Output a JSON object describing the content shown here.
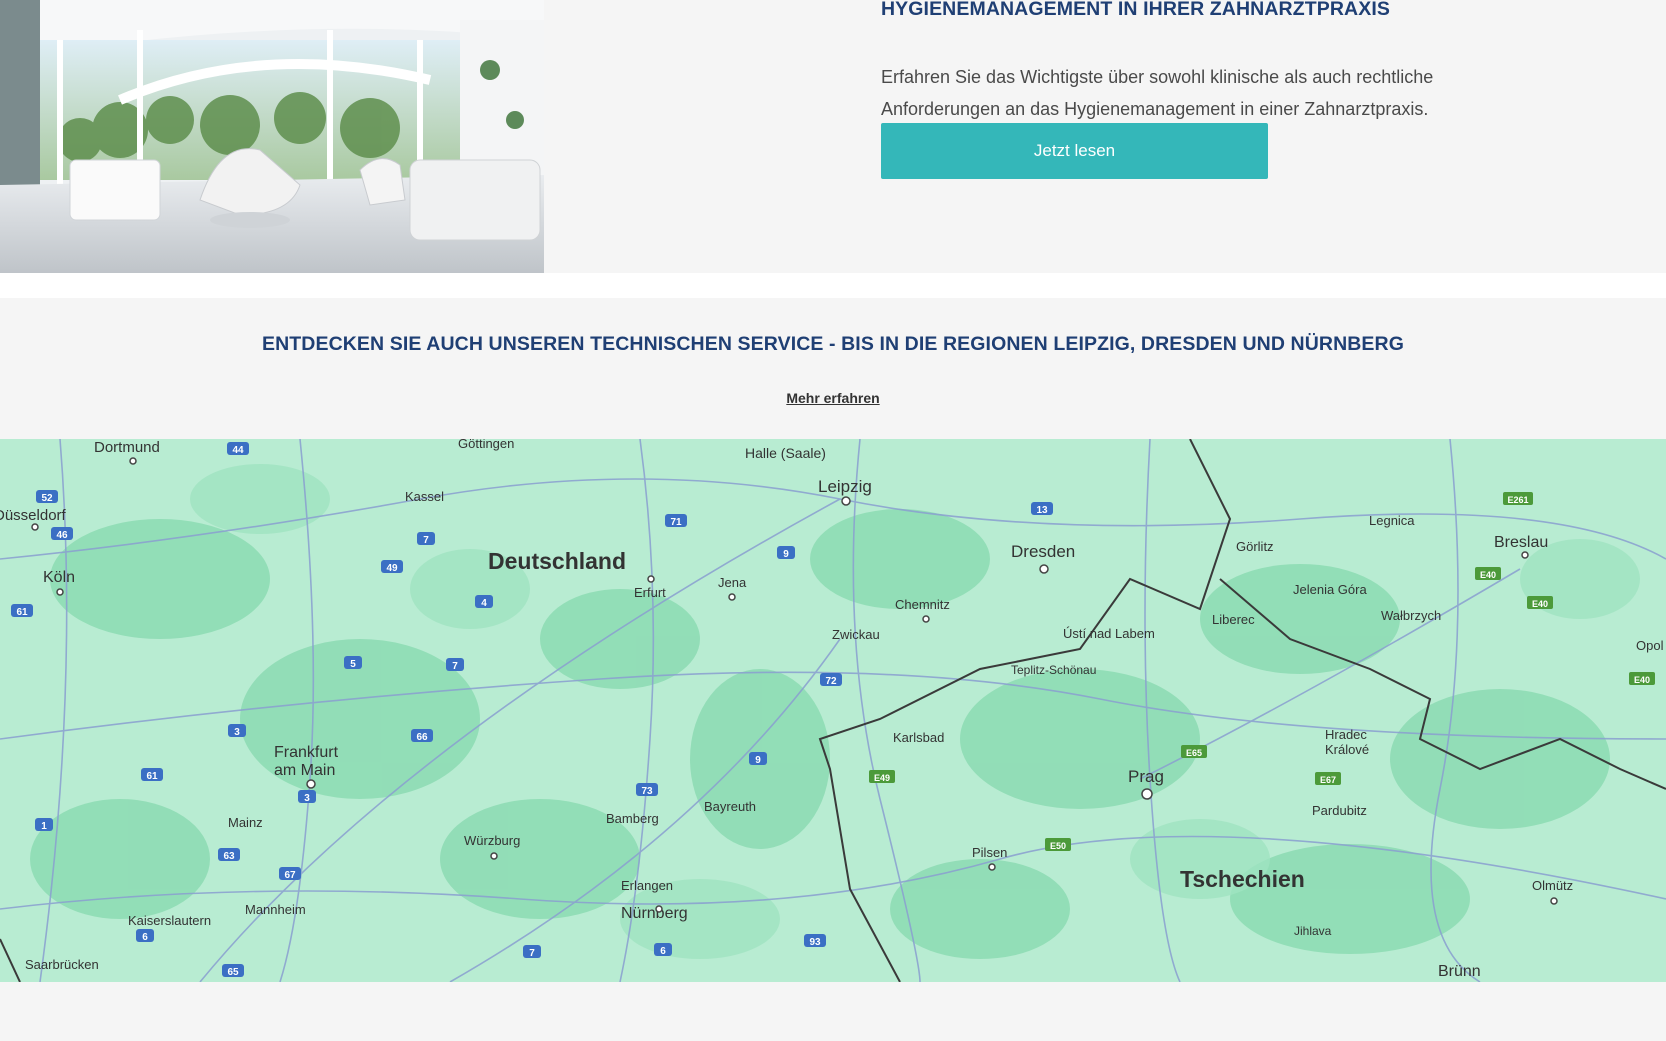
{
  "hero": {
    "title": "HYGIENEMANAGEMENT IN IHRER ZAHNARZTPRAXIS",
    "description": "Erfahren Sie das Wichtigste über sowohl klinische als auch rechtliche Anforderungen an das Hygienemanagement in einer Zahnarztpraxis.",
    "cta_label": "Jetzt lesen"
  },
  "service": {
    "title": "ENTDECKEN SIE AUCH UNSEREN TECHNISCHEN SERVICE - BIS IN DIE REGIONEN LEIPZIG, DRESDEN UND NÜRNBERG",
    "link_label": "Mehr erfahren"
  },
  "map": {
    "countries": {
      "de": "Deutschland",
      "cz": "Tschechien"
    },
    "cities": {
      "dortmund": "Dortmund",
      "goettingen": "Göttingen",
      "halle": "Halle (Saale)",
      "leipzig": "Leipzig",
      "kassel": "Kassel",
      "duesseldorf": "Düsseldorf",
      "koeln": "Köln",
      "erfurt": "Erfurt",
      "jena": "Jena",
      "dresden": "Dresden",
      "goerlitz": "Görlitz",
      "legnica": "Legnica",
      "breslau": "Breslau",
      "jelenia": "Jelenia Góra",
      "walbrzych": "Wałbrzych",
      "liberec": "Liberec",
      "chemnitz": "Chemnitz",
      "zwickau": "Zwickau",
      "usti": "Ústí nad Labem",
      "teplitz": "Teplitz-Schönau",
      "opole": "Opol",
      "frankfurt1": "Frankfurt",
      "frankfurt2": "am Main",
      "karlsbad": "Karlsbad",
      "prag": "Prag",
      "hradec1": "Hradec",
      "hradec2": "Králové",
      "pardubitz": "Pardubitz",
      "mainz": "Mainz",
      "bamberg": "Bamberg",
      "bayreuth": "Bayreuth",
      "wuerzburg": "Würzburg",
      "pilsen": "Pilsen",
      "erlangen": "Erlangen",
      "nuernberg": "Nürnberg",
      "olmuetz": "Olmütz",
      "jihlava": "Jihlava",
      "kaiserslautern": "Kaiserslautern",
      "mannheim": "Mannheim",
      "saarbruecken": "Saarbrücken",
      "bruenn": "Brünn"
    },
    "shields": {
      "a44": "44",
      "a52": "52",
      "a46": "46",
      "a61": "61",
      "a7a": "7",
      "a49": "49",
      "a4": "4",
      "a71": "71",
      "a9a": "9",
      "a13": "13",
      "a5": "5",
      "a7b": "7",
      "a3": "3",
      "a66": "66",
      "a72": "72",
      "a9b": "9",
      "a73": "73",
      "a61b": "61",
      "a3b": "3",
      "a1": "1",
      "a63": "63",
      "a67": "67",
      "a6a": "6",
      "a6b": "6",
      "a7c": "7",
      "a93": "93",
      "a65": "65",
      "e261": "E261",
      "e40a": "E40",
      "e40b": "E40",
      "e40c": "E40",
      "e65": "E65",
      "e67": "E67",
      "e49": "E49",
      "e50": "E50"
    }
  }
}
